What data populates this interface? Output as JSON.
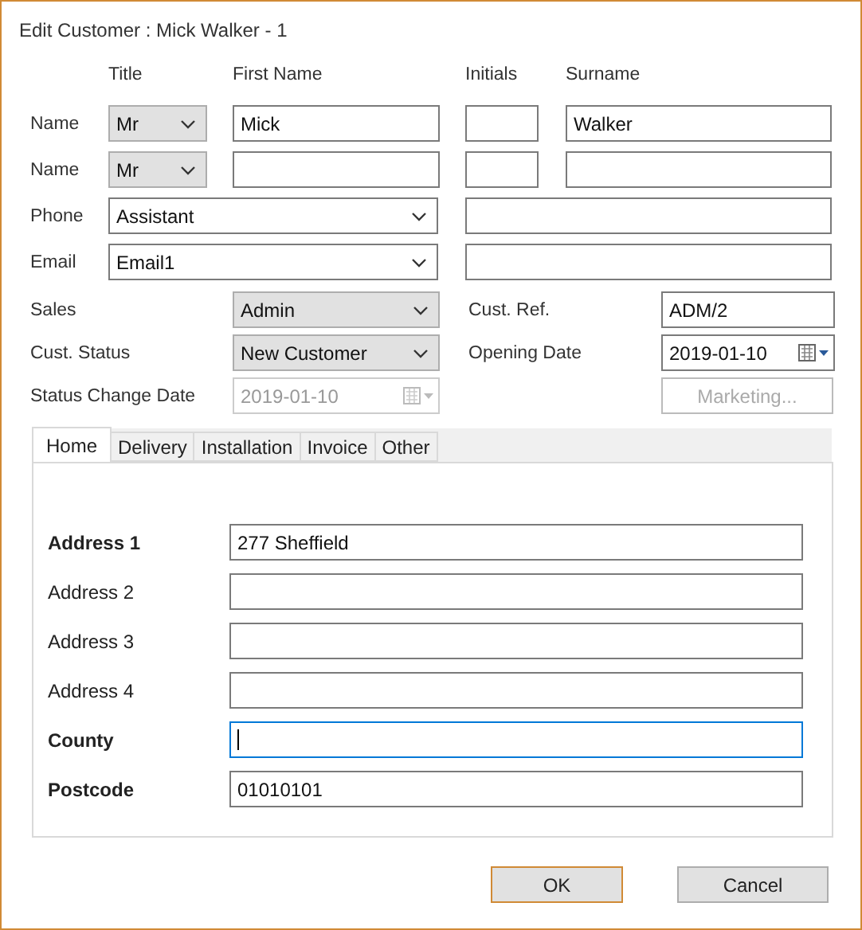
{
  "window": {
    "title": "Edit Customer : Mick Walker - 1"
  },
  "name_headers": [
    "Title",
    "First Name",
    "Initials",
    "Surname"
  ],
  "name_rows": [
    {
      "label": "Name",
      "title": "Mr",
      "first_name": "Mick",
      "surname": "Walker"
    },
    {
      "label": "Name",
      "title": "Mr"
    }
  ],
  "contact_rows": [
    {
      "label": "Phone",
      "type": "Assistant"
    },
    {
      "label": "Email",
      "type": "Email1"
    }
  ],
  "sales": {
    "label": "Sales",
    "value": "Admin"
  },
  "cust_status": {
    "label": "Cust. Status",
    "value": "New Customer"
  },
  "status_change_date": {
    "label": "Status Change Date",
    "value": "2019-01-10",
    "disabled": true
  },
  "cust_ref": {
    "label": "Cust. Ref.",
    "value": "ADM/2"
  },
  "opening_date": {
    "label": "Opening Date",
    "value": "2019-01-10",
    "disabled": false
  },
  "marketing_button": {
    "label": "Marketing...",
    "disabled": true
  },
  "tabs": [
    {
      "label": "Home",
      "selected": true
    },
    {
      "label": "Delivery",
      "selected": false
    },
    {
      "label": "Installation",
      "selected": false
    },
    {
      "label": "Invoice",
      "selected": false
    },
    {
      "label": "Other",
      "selected": false
    }
  ],
  "address_fields": [
    {
      "label": "Address 1",
      "value": "277 Sheffield",
      "required": true,
      "focused": false
    },
    {
      "label": "Address 2",
      "required": false,
      "focused": false
    },
    {
      "label": "Address 3",
      "required": false,
      "focused": false
    },
    {
      "label": "Address 4",
      "required": false,
      "focused": false
    },
    {
      "label": "County",
      "required": true,
      "focused": true
    },
    {
      "label": "Postcode",
      "value": "01010101",
      "required": true,
      "focused": false
    }
  ],
  "buttons": [
    {
      "label": "OK",
      "default": true
    },
    {
      "label": "Cancel",
      "default": false
    }
  ]
}
